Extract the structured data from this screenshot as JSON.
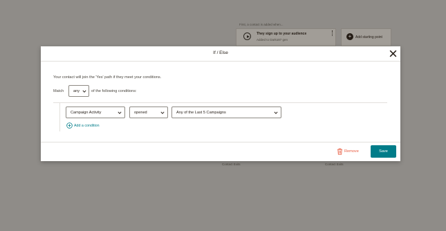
{
  "background": {
    "caption": "First, a contact is added when...",
    "trigger": {
      "title": "They sign up to your audience",
      "subtitle": "Added to Darko87 gen"
    },
    "start_label": "Add starting point",
    "exit_labels": [
      "Contact Exits",
      "Contact Exits"
    ]
  },
  "modal": {
    "title": "If / Else",
    "intro": "Your contact will join the 'Yes' path if they meet your conditions.",
    "match_label": "Match",
    "match_value": "any",
    "match_suffix": "of the following conditions:",
    "condition": {
      "field": "Campaign Activity",
      "operator": "opened",
      "value": "Any of the Last 5 Campaigns"
    },
    "add_condition_label": "Add a condition",
    "remove_label": "Remove",
    "save_label": "Save"
  },
  "colors": {
    "accent": "#007c89",
    "danger": "#e85c41",
    "overlay": "#8f8c88"
  },
  "icons": {
    "close": "close-icon",
    "chevron": "chevron-down-icon",
    "add": "plus-circle-icon",
    "remove": "trash-icon",
    "trigger": "play-icon",
    "start": "plus-icon"
  }
}
